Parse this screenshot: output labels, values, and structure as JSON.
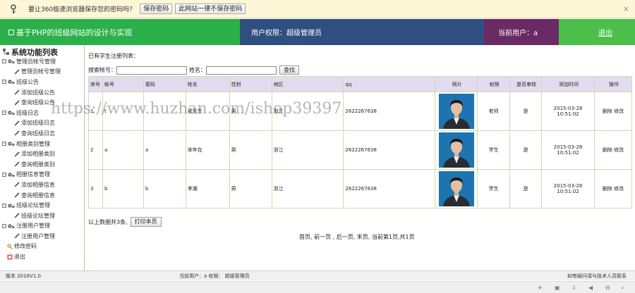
{
  "password_bar": {
    "question": "要让360极速浏览器保存您的密码吗？",
    "save_label": "保存密码",
    "never_label": "此网站一律不保存密码",
    "close": "×"
  },
  "header": {
    "title": "基于PHP的班级网站的设计与实现",
    "permission": "用户权限：超级管理员",
    "current_user": "当前用户：a",
    "logout": "退出"
  },
  "sidebar": {
    "heading": "系统功能列表",
    "items": [
      {
        "label": "管理员帐号管理",
        "level": 1
      },
      {
        "label": "管理员帐号管理",
        "level": 2
      },
      {
        "label": "班级公告",
        "level": 1
      },
      {
        "label": "添加班级公告",
        "level": 2
      },
      {
        "label": "查询班级公告",
        "level": 2
      },
      {
        "label": "班级日志",
        "level": 1
      },
      {
        "label": "添加班级日志",
        "level": 2
      },
      {
        "label": "查询班级日志",
        "level": 2
      },
      {
        "label": "相册类别管理",
        "level": 1
      },
      {
        "label": "添加相册类别",
        "level": 2
      },
      {
        "label": "查询相册类别",
        "level": 2
      },
      {
        "label": "相册信息管理",
        "level": 1
      },
      {
        "label": "添加相册信息",
        "level": 2
      },
      {
        "label": "查询相册信息",
        "level": 2
      },
      {
        "label": "班级论坛管理",
        "level": 1
      },
      {
        "label": "班级论坛管理",
        "level": 2
      },
      {
        "label": "注册用户管理",
        "level": 1
      },
      {
        "label": "注册用户管理",
        "level": 2
      },
      {
        "label": "修改密码",
        "level": 0
      },
      {
        "label": "退出",
        "level": 0
      }
    ]
  },
  "main": {
    "caption": "已有学生注册列表：",
    "search": {
      "prefix": "搜索",
      "account_label": "帐号：",
      "account_value": "",
      "name_label": "姓名：",
      "name_value": "",
      "button": "查找"
    },
    "columns": [
      "序号",
      "帐号",
      "密码",
      "姓名",
      "性别",
      "地区",
      "qq",
      "照片",
      "权限",
      "是否审核",
      "添加时间",
      "操作"
    ],
    "rows": [
      {
        "no": "1",
        "account": "t",
        "password": "",
        "name": "张先生",
        "gender": "男",
        "region": "浙江",
        "qq": "2622267638",
        "role": "老师",
        "approved": "是",
        "time": "2015-03-28 10:51:02",
        "delete": "删除",
        "edit": "修改"
      },
      {
        "no": "2",
        "account": "a",
        "password": "a",
        "name": "宋年在",
        "gender": "男",
        "region": "浙江",
        "qq": "2622267638",
        "role": "学生",
        "approved": "是",
        "time": "2015-03-28 10:51:02",
        "delete": "删除",
        "edit": "修改"
      },
      {
        "no": "3",
        "account": "b",
        "password": "b",
        "name": "李潮",
        "gender": "男",
        "region": "浙江",
        "qq": "2622267638",
        "role": "学生",
        "approved": "是",
        "time": "2015-03-28 10:51:02",
        "delete": "删除",
        "edit": "修改"
      }
    ],
    "total": "以上数据共3条,",
    "print_button": "打印本页",
    "pager": "首页, 前一页 , 后一页, 末页, 当前第1页,共1页"
  },
  "status": {
    "version": "版本 2016V1.0",
    "who": "当前用户：a 权限： 超级管理员",
    "contact": "如有疑问请与技术人员联系"
  },
  "watermark": "https://www.huzhan.com/ishop39397",
  "colors": {
    "title_green": "#2bb04a",
    "perm_blue": "#2f4f80",
    "user_purple": "#6a2a66",
    "logout_green": "#4bbf4a",
    "table_header": "#e3dcf0"
  }
}
